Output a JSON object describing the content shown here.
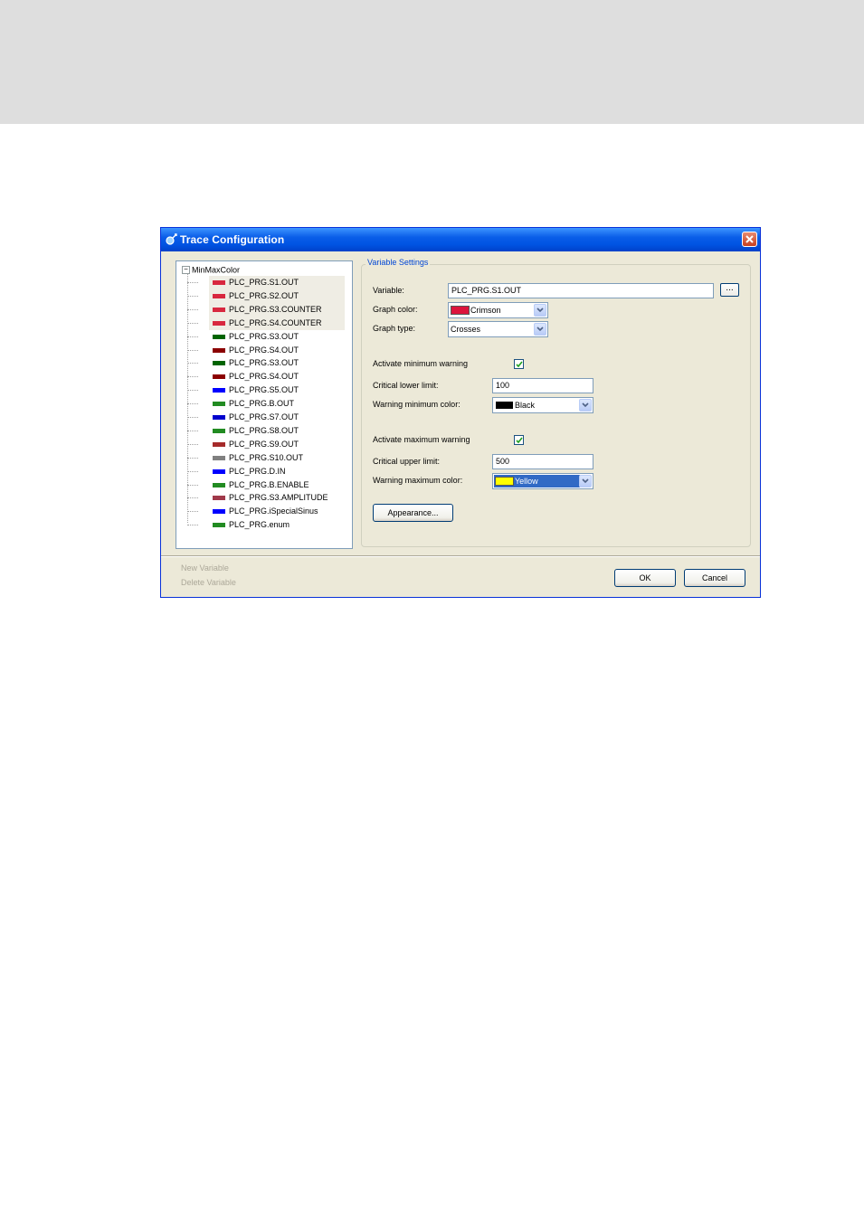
{
  "dialog": {
    "title": "Trace Configuration",
    "tree": {
      "root": "MinMaxColor",
      "items": [
        {
          "label": "PLC_PRG.S1.OUT",
          "color": "#d8283f",
          "selected": true
        },
        {
          "label": "PLC_PRG.S2.OUT",
          "color": "#d8283f",
          "selected": true
        },
        {
          "label": "PLC_PRG.S3.COUNTER",
          "color": "#d8283f",
          "selected": true
        },
        {
          "label": "PLC_PRG.S4.COUNTER",
          "color": "#d8283f",
          "selected": true
        },
        {
          "label": "PLC_PRG.S3.OUT",
          "color": "#006400",
          "selected": false
        },
        {
          "label": "PLC_PRG.S4.OUT",
          "color": "#8b0000",
          "selected": false
        },
        {
          "label": "PLC_PRG.S3.OUT",
          "color": "#006400",
          "selected": false
        },
        {
          "label": "PLC_PRG.S4.OUT",
          "color": "#8b0000",
          "selected": false
        },
        {
          "label": "PLC_PRG.S5.OUT",
          "color": "#0000ff",
          "selected": false
        },
        {
          "label": "PLC_PRG.B.OUT",
          "color": "#228b22",
          "selected": false
        },
        {
          "label": "PLC_PRG.S7.OUT",
          "color": "#0000cd",
          "selected": false
        },
        {
          "label": "PLC_PRG.S8.OUT",
          "color": "#228b22",
          "selected": false
        },
        {
          "label": "PLC_PRG.S9.OUT",
          "color": "#a52a2a",
          "selected": false
        },
        {
          "label": "PLC_PRG.S10.OUT",
          "color": "#808080",
          "selected": false
        },
        {
          "label": "PLC_PRG.D.IN",
          "color": "#0000ff",
          "selected": false
        },
        {
          "label": "PLC_PRG.B.ENABLE",
          "color": "#228b22",
          "selected": false
        },
        {
          "label": "PLC_PRG.S3.AMPLITUDE",
          "color": "#a0394a",
          "selected": false
        },
        {
          "label": "PLC_PRG.iSpecialSinus",
          "color": "#0000ff",
          "selected": false
        },
        {
          "label": "PLC_PRG.enum",
          "color": "#228b22",
          "selected": false
        }
      ]
    },
    "settings": {
      "group_title": "Variable Settings",
      "variable_label": "Variable:",
      "variable_value": "PLC_PRG.S1.OUT",
      "browse_label": "...",
      "graph_color_label": "Graph color:",
      "graph_color_value": "Crimson",
      "graph_color_swatch": "#dc143c",
      "graph_type_label": "Graph type:",
      "graph_type_value": "Crosses",
      "activate_min_label": "Activate minimum warning",
      "activate_min_checked": true,
      "critical_lower_label": "Critical lower limit:",
      "critical_lower_value": "100",
      "warning_min_color_label": "Warning minimum color:",
      "warning_min_color_value": "Black",
      "warning_min_color_swatch": "#000000",
      "activate_max_label": "Activate maximum warning",
      "activate_max_checked": true,
      "critical_upper_label": "Critical upper limit:",
      "critical_upper_value": "500",
      "warning_max_color_label": "Warning maximum color:",
      "warning_max_color_value": "Yellow",
      "warning_max_color_swatch": "#ffff00",
      "appearance_label": "Appearance..."
    },
    "footer": {
      "new_variable": "New Variable",
      "delete_variable": "Delete Variable",
      "ok_label": "OK",
      "cancel_label": "Cancel"
    }
  }
}
